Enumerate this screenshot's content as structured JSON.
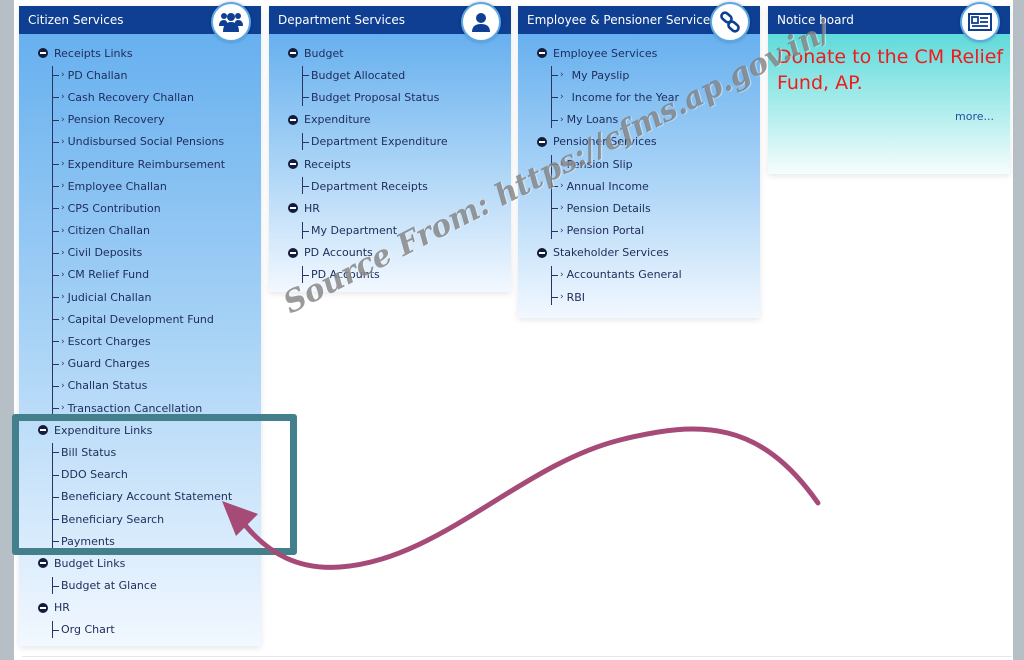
{
  "cards": {
    "citizen": {
      "title": "Citizen Services",
      "icon": "users-icon",
      "groups": [
        {
          "title": "Receipts Links",
          "items": [
            "PD Challan",
            "Cash Recovery Challan",
            "Pension Recovery",
            "Undisbursed Social Pensions",
            "Expenditure Reimbursement",
            "Employee Challan",
            "CPS Contribution",
            "Citizen Challan",
            "Civil Deposits",
            "CM Relief Fund",
            "Judicial Challan",
            "Capital Development Fund",
            "Escort Charges",
            "Guard Charges",
            "Challan Status",
            "Transaction Cancellation"
          ]
        },
        {
          "title": "Expenditure Links",
          "items": [
            "Bill Status",
            "DDO Search",
            "Beneficiary Account Statement",
            "Beneficiary Search",
            "Payments"
          ]
        },
        {
          "title": "Budget Links",
          "items": [
            "Budget at Glance"
          ]
        },
        {
          "title": "HR",
          "items": [
            "Org Chart"
          ]
        }
      ]
    },
    "department": {
      "title": "Department Services",
      "icon": "user-icon",
      "groups": [
        {
          "title": "Budget",
          "items": [
            "Budget Allocated",
            "Budget Proposal Status"
          ]
        },
        {
          "title": "Expenditure",
          "items": [
            "Department Expenditure"
          ]
        },
        {
          "title": "Receipts",
          "items": [
            "Department Receipts"
          ]
        },
        {
          "title": "HR",
          "items": [
            "My Department"
          ]
        },
        {
          "title": "PD Accounts",
          "items": [
            "PD Accounts"
          ]
        }
      ]
    },
    "employee": {
      "title": "Employee & Pensioner Services",
      "icon": "link-icon",
      "groups": [
        {
          "title": "Employee Services",
          "items": [
            "My Payslip",
            "Income for the Year",
            "My Loans"
          ]
        },
        {
          "title": "Pensioner Services",
          "items": [
            "Pension Slip",
            "Annual Income",
            "Pension Details",
            "Pension Portal"
          ]
        },
        {
          "title": "Stakeholder Services",
          "items": [
            "Accountants General",
            "RBI"
          ]
        }
      ]
    },
    "notice": {
      "title": "Notice board",
      "icon": "newspaper-icon",
      "message": "Donate to the CM Relief Fund, AP.",
      "more_label": "more..."
    }
  },
  "annotations": {
    "watermark": "Source From: https://cfms.ap.gov.in/",
    "highlight_color": "#43808c",
    "arrow_color": "#a64b78"
  },
  "colors": {
    "header_bg": "#0f3f92",
    "notice_text": "#ef1b1b",
    "link_text": "#1e2c5a"
  }
}
